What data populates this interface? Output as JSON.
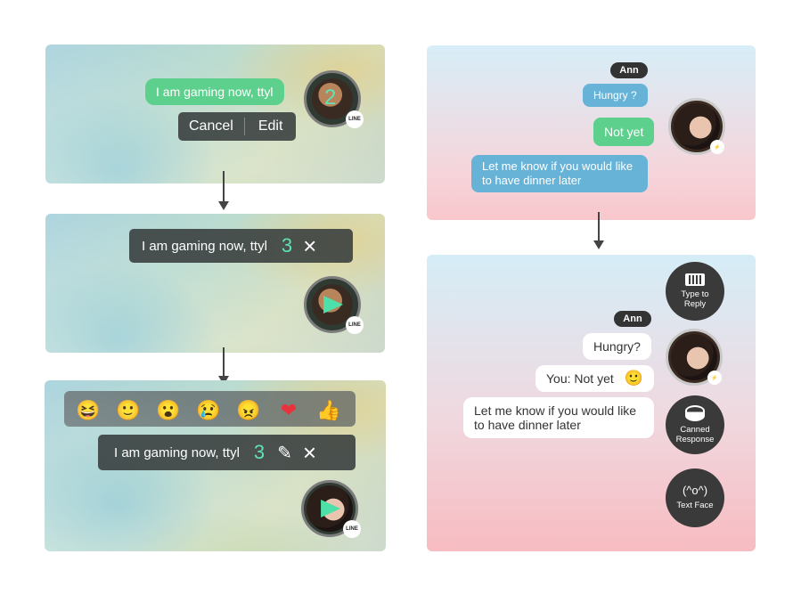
{
  "line_flow": {
    "message_text": "I am gaming now, ttyl",
    "step1": {
      "count": "2",
      "cancel_label": "Cancel",
      "edit_label": "Edit",
      "badge": "LINE"
    },
    "step2": {
      "count": "3",
      "close_icon": "×",
      "badge": "LINE"
    },
    "step3": {
      "count": "3",
      "edit_icon": "✎",
      "close_icon": "×",
      "badge": "LINE",
      "reactions": [
        {
          "name": "laughing",
          "glyph": "😆"
        },
        {
          "name": "smile",
          "glyph": "🙂"
        },
        {
          "name": "wow",
          "glyph": "😮"
        },
        {
          "name": "sad",
          "glyph": "😢"
        },
        {
          "name": "angry",
          "glyph": "😠"
        },
        {
          "name": "heart",
          "glyph": "❤"
        },
        {
          "name": "thumbs-up",
          "glyph": "👍"
        }
      ]
    }
  },
  "messenger_flow": {
    "chat1": {
      "sender_name": "Ann",
      "incoming": "Hungry ?",
      "reply": "Not yet",
      "incoming2": "Let me know if you would like to have dinner later"
    },
    "chat2": {
      "sender_name": "Ann",
      "incoming": "Hungry?",
      "reply": "You: Not yet",
      "reply_emoji": "🙂",
      "incoming2": "Let me know if you would like to have dinner later",
      "actions": [
        {
          "label": "Type to Reply",
          "icon": "keyboard-icon"
        },
        {
          "label": "Canned Response",
          "icon": "canned-icon"
        },
        {
          "label": "Text Face",
          "face": "(^o^)"
        }
      ]
    }
  },
  "colors": {
    "bubble_green": "#5ed08d",
    "bubble_blue": "#67b3d8",
    "count_green": "#5fe3b6",
    "dark_bar": "#373c3c"
  }
}
